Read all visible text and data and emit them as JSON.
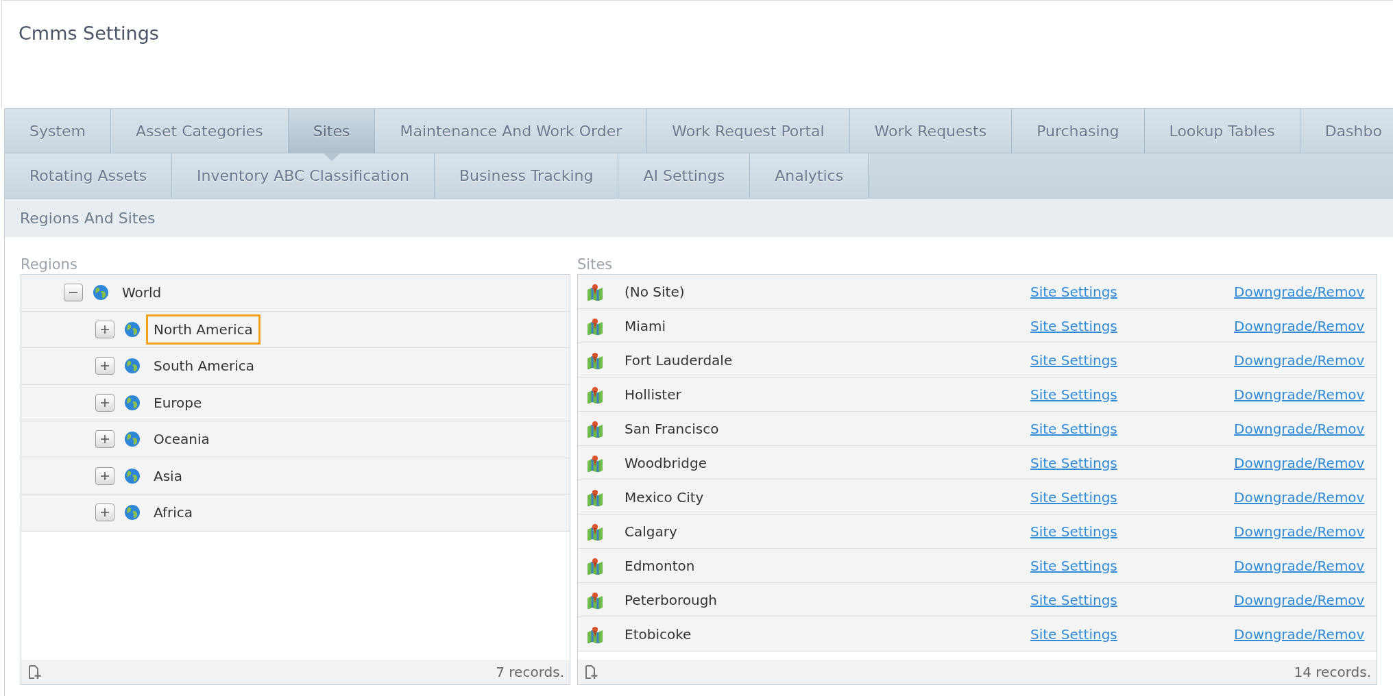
{
  "title": "Cmms Settings",
  "tabs": {
    "row_1": [
      {
        "label": "System",
        "selected": false
      },
      {
        "label": "Asset Categories",
        "selected": false
      },
      {
        "label": "Sites",
        "selected": true
      },
      {
        "label": "Maintenance And Work Order",
        "selected": false
      },
      {
        "label": "Work Request Portal",
        "selected": false
      },
      {
        "label": "Work Requests",
        "selected": false
      },
      {
        "label": "Purchasing",
        "selected": false
      },
      {
        "label": "Lookup Tables",
        "selected": false
      },
      {
        "label": "Dashbo",
        "selected": false
      }
    ],
    "row_2": [
      {
        "label": "Rotating Assets",
        "selected": false
      },
      {
        "label": "Inventory ABC Classification",
        "selected": false
      },
      {
        "label": "Business Tracking",
        "selected": false
      },
      {
        "label": "AI Settings",
        "selected": false
      },
      {
        "label": "Analytics",
        "selected": false
      }
    ]
  },
  "section_title": "Regions And Sites",
  "regions": {
    "label": "Regions",
    "tree": [
      {
        "label": "World",
        "expanded": true,
        "selected": false,
        "children": [
          {
            "label": "North America",
            "expanded": false,
            "selected": true
          },
          {
            "label": "South America",
            "expanded": false,
            "selected": false
          },
          {
            "label": "Europe",
            "expanded": false,
            "selected": false
          },
          {
            "label": "Oceania",
            "expanded": false,
            "selected": false
          },
          {
            "label": "Asia",
            "expanded": false,
            "selected": false
          },
          {
            "label": "Africa",
            "expanded": false,
            "selected": false
          }
        ]
      }
    ],
    "footer": "7 records."
  },
  "sites": {
    "label": "Sites",
    "rows": [
      {
        "name": "(No Site)",
        "settings_link": "Site Settings",
        "action_link": "Downgrade/Remov"
      },
      {
        "name": "Miami",
        "settings_link": "Site Settings",
        "action_link": "Downgrade/Remov"
      },
      {
        "name": "Fort Lauderdale",
        "settings_link": "Site Settings",
        "action_link": "Downgrade/Remov"
      },
      {
        "name": "Hollister",
        "settings_link": "Site Settings",
        "action_link": "Downgrade/Remov"
      },
      {
        "name": "San Francisco",
        "settings_link": "Site Settings",
        "action_link": "Downgrade/Remov"
      },
      {
        "name": "Woodbridge",
        "settings_link": "Site Settings",
        "action_link": "Downgrade/Remov"
      },
      {
        "name": "Mexico City",
        "settings_link": "Site Settings",
        "action_link": "Downgrade/Remov"
      },
      {
        "name": "Calgary",
        "settings_link": "Site Settings",
        "action_link": "Downgrade/Remov"
      },
      {
        "name": "Edmonton",
        "settings_link": "Site Settings",
        "action_link": "Downgrade/Remov"
      },
      {
        "name": "Peterborough",
        "settings_link": "Site Settings",
        "action_link": "Downgrade/Remov"
      },
      {
        "name": "Etobicoke",
        "settings_link": "Site Settings",
        "action_link": "Downgrade/Remov"
      }
    ],
    "footer": "14 records."
  }
}
